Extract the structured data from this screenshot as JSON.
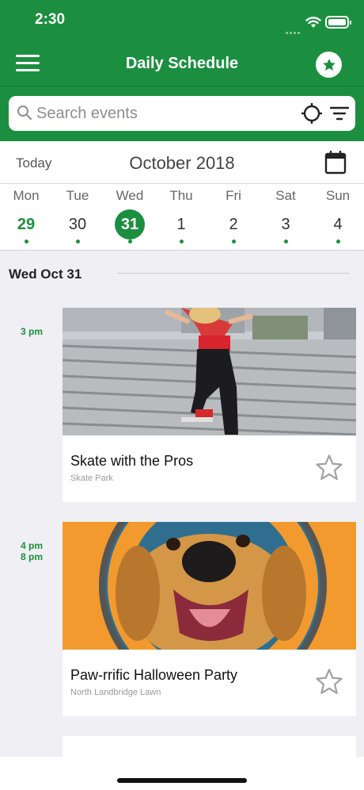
{
  "status_bar": {
    "time": "2:30"
  },
  "header": {
    "title": "Daily Schedule"
  },
  "search": {
    "placeholder": "Search events"
  },
  "calendar": {
    "today_label": "Today",
    "month": "October 2018",
    "days": [
      {
        "name": "Mon",
        "num": "29"
      },
      {
        "name": "Tue",
        "num": "30"
      },
      {
        "name": "Wed",
        "num": "31"
      },
      {
        "name": "Thu",
        "num": "1"
      },
      {
        "name": "Fri",
        "num": "2"
      },
      {
        "name": "Sat",
        "num": "3"
      },
      {
        "name": "Sun",
        "num": "4"
      }
    ],
    "selected_index": 2,
    "current_index": 0
  },
  "schedule": {
    "date_header": "Wed Oct 31",
    "events": [
      {
        "start": "3 pm",
        "end": "",
        "title": "Skate with the Pros",
        "location": "Skate Park"
      },
      {
        "start": "4 pm",
        "end": "8 pm",
        "title": "Paw-rrific Halloween Party",
        "location": "North Landbridge Lawn"
      }
    ]
  },
  "colors": {
    "accent": "#1b8f3f",
    "background": "#efeff4"
  }
}
